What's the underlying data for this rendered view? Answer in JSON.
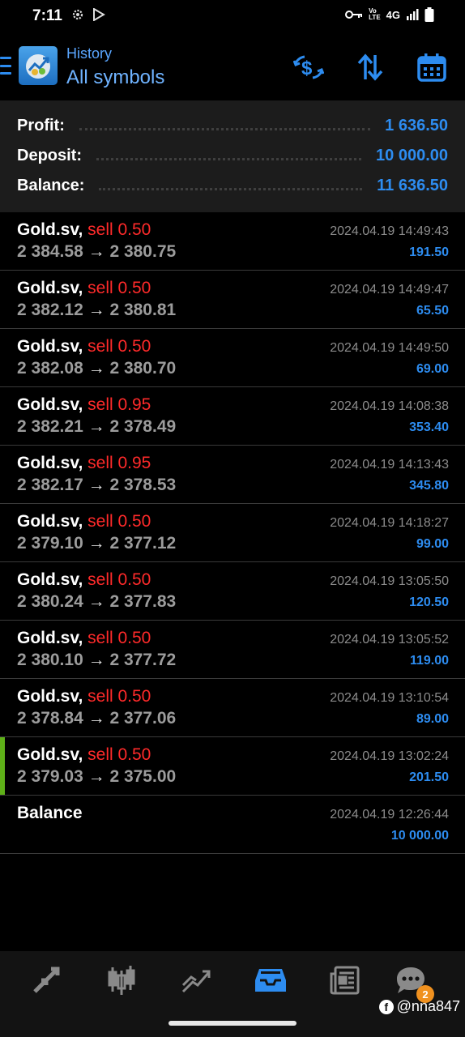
{
  "status_bar": {
    "time": "7:11",
    "network": "4G"
  },
  "header": {
    "title": "History",
    "subtitle": "All symbols",
    "accent_color": "#2d8cf0"
  },
  "summary": {
    "profit_label": "Profit:",
    "profit_value": "1 636.50",
    "deposit_label": "Deposit:",
    "deposit_value": "10 000.00",
    "balance_label": "Balance:",
    "balance_value": "11 636.50"
  },
  "deals": [
    {
      "symbol": "Gold.sv,",
      "side": "sell 0.50",
      "open": "2 384.58",
      "close": "2 380.75",
      "arrow": "→",
      "time": "2024.04.19 14:49:43",
      "profit": "191.50"
    },
    {
      "symbol": "Gold.sv,",
      "side": "sell 0.50",
      "open": "2 382.12",
      "close": "2 380.81",
      "arrow": "→",
      "time": "2024.04.19 14:49:47",
      "profit": "65.50"
    },
    {
      "symbol": "Gold.sv,",
      "side": "sell 0.50",
      "open": "2 382.08",
      "close": "2 380.70",
      "arrow": "→",
      "time": "2024.04.19 14:49:50",
      "profit": "69.00"
    },
    {
      "symbol": "Gold.sv,",
      "side": "sell 0.95",
      "open": "2 382.21",
      "close": "2 378.49",
      "arrow": "→",
      "time": "2024.04.19 14:08:38",
      "profit": "353.40"
    },
    {
      "symbol": "Gold.sv,",
      "side": "sell 0.95",
      "open": "2 382.17",
      "close": "2 378.53",
      "arrow": "→",
      "time": "2024.04.19 14:13:43",
      "profit": "345.80"
    },
    {
      "symbol": "Gold.sv,",
      "side": "sell 0.50",
      "open": "2 379.10",
      "close": "2 377.12",
      "arrow": "→",
      "time": "2024.04.19 14:18:27",
      "profit": "99.00"
    },
    {
      "symbol": "Gold.sv,",
      "side": "sell 0.50",
      "open": "2 380.24",
      "close": "2 377.83",
      "arrow": "→",
      "time": "2024.04.19 13:05:50",
      "profit": "120.50"
    },
    {
      "symbol": "Gold.sv,",
      "side": "sell 0.50",
      "open": "2 380.10",
      "close": "2 377.72",
      "arrow": "→",
      "time": "2024.04.19 13:05:52",
      "profit": "119.00"
    },
    {
      "symbol": "Gold.sv,",
      "side": "sell 0.50",
      "open": "2 378.84",
      "close": "2 377.06",
      "arrow": "→",
      "time": "2024.04.19 13:10:54",
      "profit": "89.00"
    },
    {
      "symbol": "Gold.sv,",
      "side": "sell 0.50",
      "open": "2 379.03",
      "close": "2 375.00",
      "arrow": "→",
      "time": "2024.04.19 13:02:24",
      "profit": "201.50"
    }
  ],
  "balance_entry": {
    "label": "Balance",
    "time": "2024.04.19 12:26:44",
    "amount": "10 000.00"
  },
  "bottom_nav": {
    "items": [
      "quotes-icon",
      "chart-icon",
      "trade-icon",
      "history-icon",
      "news-icon",
      "chat-icon"
    ],
    "chat_badge": "2",
    "watermark": "@nna847"
  }
}
